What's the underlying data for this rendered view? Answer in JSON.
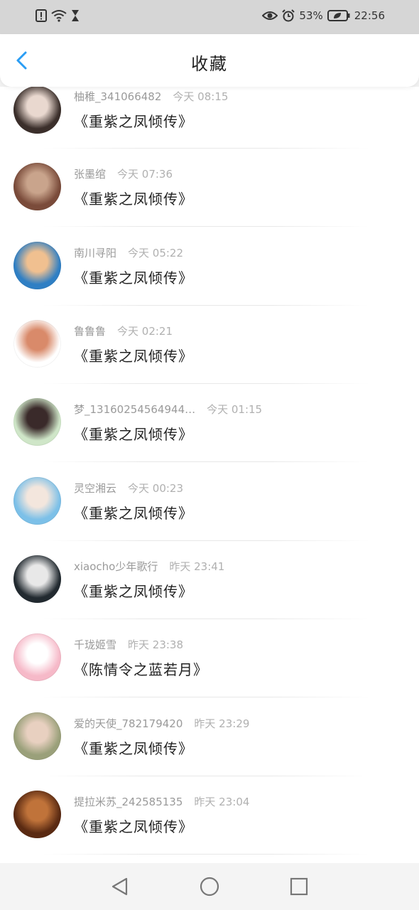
{
  "status_bar": {
    "battery_percent": "53%",
    "time": "22:56",
    "icons": [
      "alert-icon",
      "wifi-icon",
      "hourglass-icon",
      "eye-icon",
      "alarm-icon",
      "battery-icon"
    ]
  },
  "header": {
    "title": "收藏",
    "back_icon": "chevron-left-icon",
    "accent_color": "#2a9df4"
  },
  "items": [
    {
      "user": "柚稚_341066482",
      "time": "今天 08:15",
      "book": "《重紫之凤倾传》",
      "avatar_colors": [
        "#3b2f2b",
        "#e9d8cf"
      ]
    },
    {
      "user": "张墨绾",
      "time": "今天 07:36",
      "book": "《重紫之凤倾传》",
      "avatar_colors": [
        "#7a4b3a",
        "#c9a48c"
      ]
    },
    {
      "user": "南川寻阳",
      "time": "今天 05:22",
      "book": "《重紫之凤倾传》",
      "avatar_colors": [
        "#2f7fc4",
        "#f0c090"
      ]
    },
    {
      "user": "鲁鲁鲁",
      "time": "今天 02:21",
      "book": "《重紫之凤倾传》",
      "avatar_colors": [
        "#ffffff",
        "#d98a6a"
      ]
    },
    {
      "user": "梦_13160254564944…",
      "time": "今天 01:15",
      "book": "《重紫之凤倾传》",
      "avatar_colors": [
        "#cfe6c8",
        "#3a2a2a"
      ]
    },
    {
      "user": "灵空湘云",
      "time": "今天 00:23",
      "book": "《重紫之凤倾传》",
      "avatar_colors": [
        "#7cc0e8",
        "#f3e6dd"
      ]
    },
    {
      "user": "xiaocho少年歌行",
      "time": "昨天 23:41",
      "book": "《重紫之凤倾传》",
      "avatar_colors": [
        "#222a30",
        "#e8e8e8"
      ]
    },
    {
      "user": "千珑姬雪",
      "time": "昨天 23:38",
      "book": "《陈情令之蓝若月》",
      "avatar_colors": [
        "#f6b9c8",
        "#ffffff"
      ]
    },
    {
      "user": "爱的天使_782179420",
      "time": "昨天 23:29",
      "book": "《重紫之凤倾传》",
      "avatar_colors": [
        "#9aa07a",
        "#e8d0c0"
      ]
    },
    {
      "user": "提拉米苏_242585135",
      "time": "昨天 23:04",
      "book": "《重紫之凤倾传》",
      "avatar_colors": [
        "#5a2a12",
        "#c0733a"
      ]
    }
  ],
  "nav_bar": {
    "buttons": [
      "back-triangle-icon",
      "home-circle-icon",
      "recents-square-icon"
    ]
  }
}
